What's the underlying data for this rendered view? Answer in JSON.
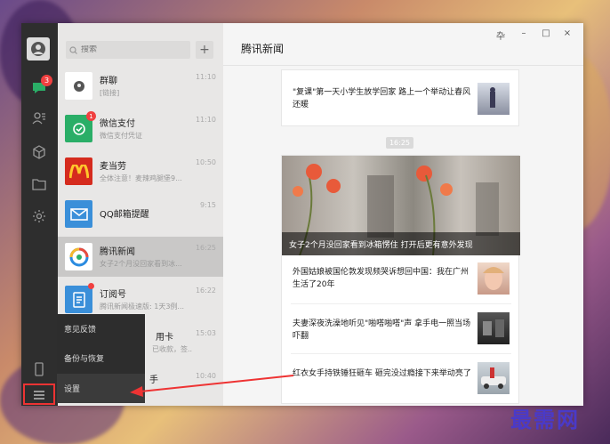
{
  "sidebar": {
    "chat_badge": "3"
  },
  "search": {
    "placeholder": "搜索"
  },
  "chats": [
    {
      "name": "群聊",
      "sub": "[链接]",
      "time": "11:10"
    },
    {
      "name": "微信支付",
      "sub": "微信支付凭证",
      "time": "11:10",
      "badge": "1"
    },
    {
      "name": "麦当劳",
      "sub": "全体注意！麦辣鸡腿堡9...",
      "time": "10:50"
    },
    {
      "name": "QQ邮箱提醒",
      "sub": "",
      "time": "9:15"
    },
    {
      "name": "腾讯新闻",
      "sub": "女子2个月没回家看到冰...",
      "time": "16:25"
    },
    {
      "name": "订阅号",
      "sub": "腾讯新闻极速版: 1天3例...",
      "time": "16:22"
    },
    {
      "name": "用卡",
      "sub": "已收款，签...",
      "time": "15:03"
    },
    {
      "name": "手",
      "sub": "",
      "time": "10:40"
    }
  ],
  "popup": {
    "items": [
      "意见反馈",
      "备份与恢复",
      "设置"
    ]
  },
  "main": {
    "title": "腾讯新闻",
    "controls": [
      "卆",
      "–",
      "□",
      "×"
    ],
    "timestamp": "16:25",
    "news1": "\"复课\"第一天小学生放学回家 路上一个举动让春风还暖",
    "big_caption": "女子2个月没回家看到冰箱愣住 打开后更有意外发现",
    "news2": "外国姑娘被国伦敦发现频哭诉想回中国：我在广州生活了20年",
    "news3": "夫妻深夜洗澡地听见\"啪嗒啪嗒\"声 拿手电一照当场吓翻",
    "news4": "红衣女手持铁锤狂砸车 砸完没过瘾接下来举动亮了"
  },
  "watermark": "最需网",
  "colors": {
    "accent_red": "#e33333",
    "wechat_green": "#2aae67",
    "mcdonalds_red": "#d52b1e",
    "mail_blue": "#3a8fd9"
  }
}
